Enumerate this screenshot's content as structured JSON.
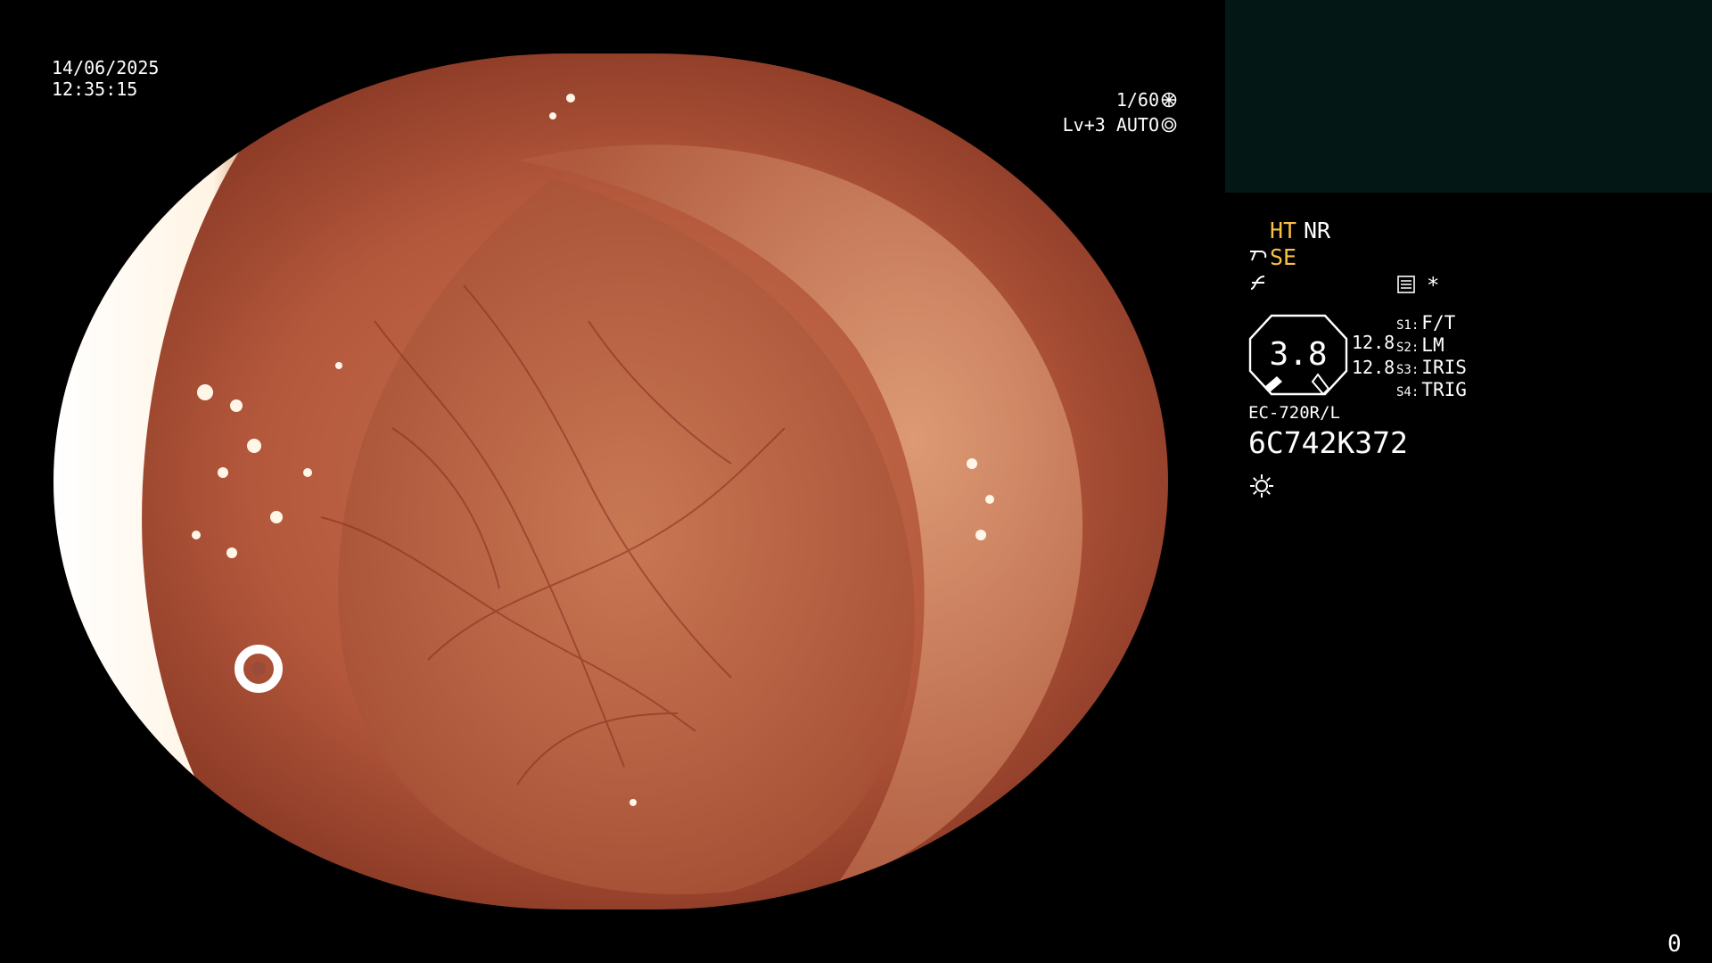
{
  "overlay": {
    "date": "14/06/2025",
    "time": "12:35:15",
    "shutter": "1/60",
    "level": "Lv+3 AUTO"
  },
  "status": {
    "ht_label": "HT",
    "nr_label": "NR",
    "se_label": "SE",
    "star_label": "*",
    "gauge_value": "3.8",
    "value_top": "12.8",
    "value_bottom": "12.8",
    "slots": [
      {
        "key": "S1:",
        "value": "F/T"
      },
      {
        "key": "S2:",
        "value": "LM"
      },
      {
        "key": "S3:",
        "value": "IRIS"
      },
      {
        "key": "S4:",
        "value": "TRIG"
      }
    ],
    "model": "EC-720R/L",
    "serial": "6C742K372"
  },
  "corner": {
    "count": "0"
  },
  "colors": {
    "highlight": "#f6c244",
    "text": "#ffffff",
    "thumbnail_panel": "#031814",
    "mucosa": "#b0523a"
  },
  "icons": [
    "shutter-icon",
    "iris-icon",
    "scope-se-icon",
    "curve-icon",
    "list-icon",
    "gauge-icon",
    "light-icon"
  ]
}
